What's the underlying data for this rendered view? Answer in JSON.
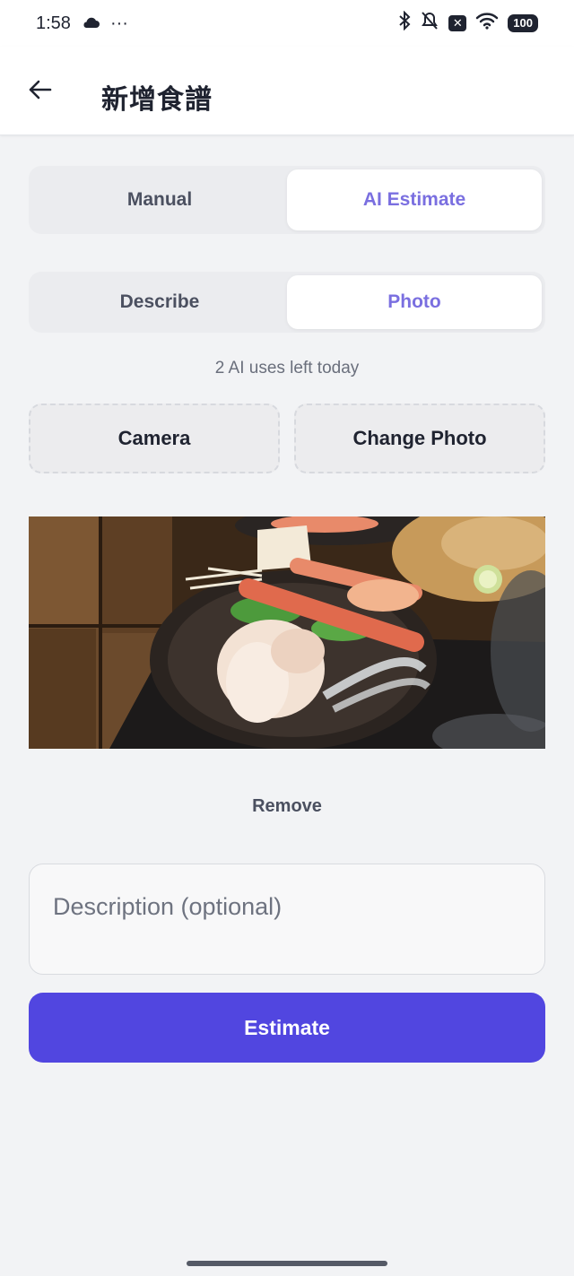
{
  "status_bar": {
    "time": "1:58",
    "more": "···",
    "battery": "100",
    "icons": [
      "cloud-icon",
      "bluetooth-icon",
      "mute-icon",
      "x-notification-icon",
      "wifi-icon",
      "battery-icon"
    ]
  },
  "header": {
    "title": "新增食譜",
    "back_icon": "arrow-left-icon"
  },
  "mode_tabs": [
    {
      "label": "Manual",
      "active": false
    },
    {
      "label": "AI Estimate",
      "active": true
    }
  ],
  "input_tabs": [
    {
      "label": "Describe",
      "active": false
    },
    {
      "label": "Photo",
      "active": true
    }
  ],
  "uses_left": "2 AI uses left today",
  "actions": {
    "camera_label": "Camera",
    "change_photo_label": "Change Photo",
    "remove_label": "Remove"
  },
  "description": {
    "placeholder": "Description (optional)",
    "value": ""
  },
  "estimate_label": "Estimate",
  "colors": {
    "accent": "#5146e0",
    "active_tab_text": "#7a6fe0",
    "background": "#f2f3f5"
  }
}
